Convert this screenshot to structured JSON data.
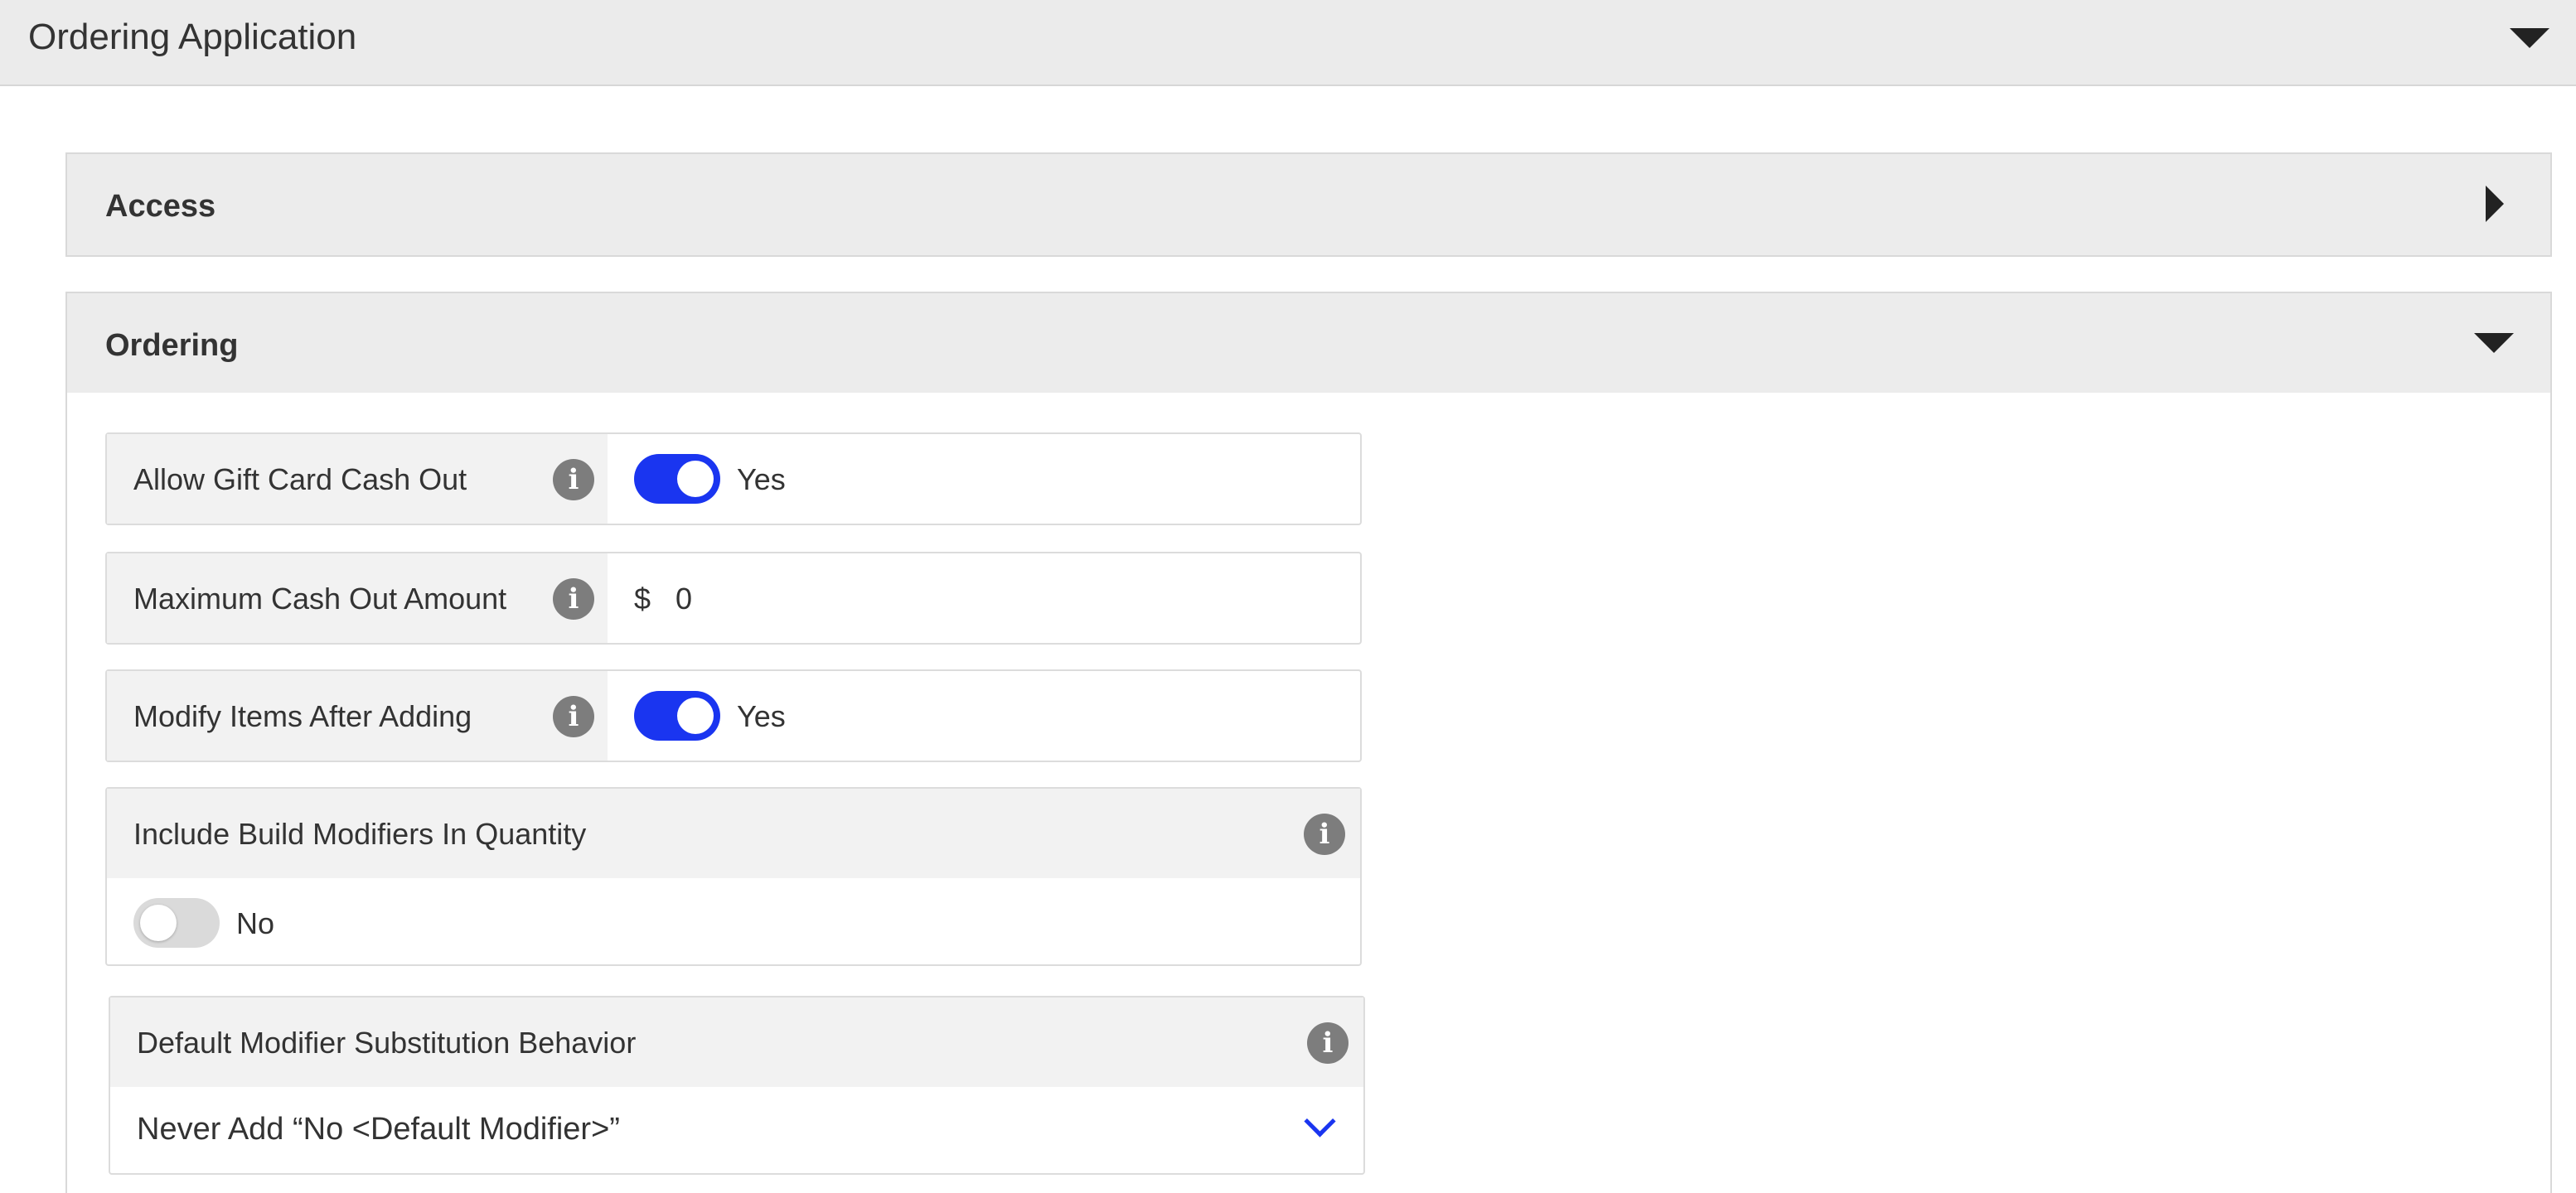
{
  "header": {
    "title": "Ordering Application"
  },
  "sections": {
    "access": {
      "label": "Access"
    },
    "ordering": {
      "label": "Ordering"
    }
  },
  "settings": {
    "allow_gift_card_cash_out": {
      "label": "Allow Gift Card Cash Out",
      "state": "Yes"
    },
    "maximum_cash_out_amount": {
      "label": "Maximum Cash Out Amount",
      "currency": "$",
      "value": "0"
    },
    "modify_items_after_adding": {
      "label": "Modify Items After Adding",
      "state": "Yes"
    },
    "include_build_modifiers": {
      "label": "Include Build Modifiers In Quantity",
      "state": "No"
    },
    "default_modifier_substitution": {
      "label": "Default Modifier Substitution Behavior",
      "selected": "Never Add “No <Default Modifier>”"
    }
  },
  "icons": {
    "info": "i"
  },
  "colors": {
    "accent": "#1a35f0",
    "toggle_off": "#dadada",
    "info_icon": "#7d7d7d"
  }
}
